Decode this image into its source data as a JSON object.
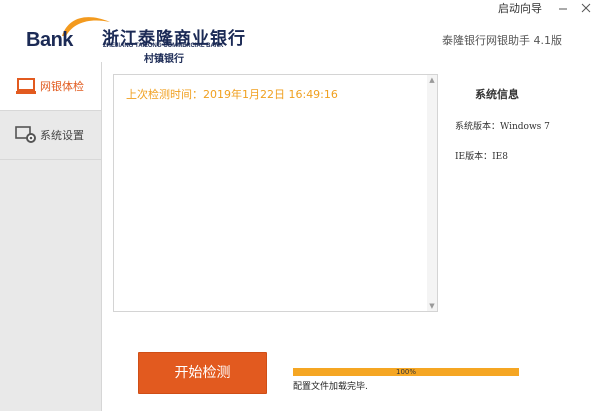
{
  "header": {
    "logo": {
      "bank_word": "Bank",
      "name_cn": "浙江泰隆商业银行",
      "name_en": "ZHEJIANG TAILONG COMMERCIAL BANK",
      "sub_name": "村镇银行"
    },
    "guide_label": "启动向导",
    "app_version": "泰隆银行网银助手 4.1版",
    "window_controls": [
      "minimize-icon",
      "close-icon"
    ]
  },
  "sidebar": {
    "items": [
      {
        "label": "网银体检",
        "icon": "laptop-icon",
        "active": true
      },
      {
        "label": "系统设置",
        "icon": "settings-gear-icon",
        "active": false
      }
    ]
  },
  "log": {
    "lines": [
      "上次检测时间：2019年1月22日 16:49:16"
    ]
  },
  "system_info": {
    "title": "系统信息",
    "os_version": "系统版本：Windows 7",
    "ie_version": "IE版本：IE8"
  },
  "actions": {
    "start_label": "开始检测"
  },
  "progress": {
    "percent": 100,
    "percent_label": "100%",
    "status": "配置文件加载完毕."
  },
  "colors": {
    "accent": "#e25a1f",
    "brand_navy": "#1b2a55",
    "log_text": "#f0a020",
    "progress": "#f5a623"
  }
}
